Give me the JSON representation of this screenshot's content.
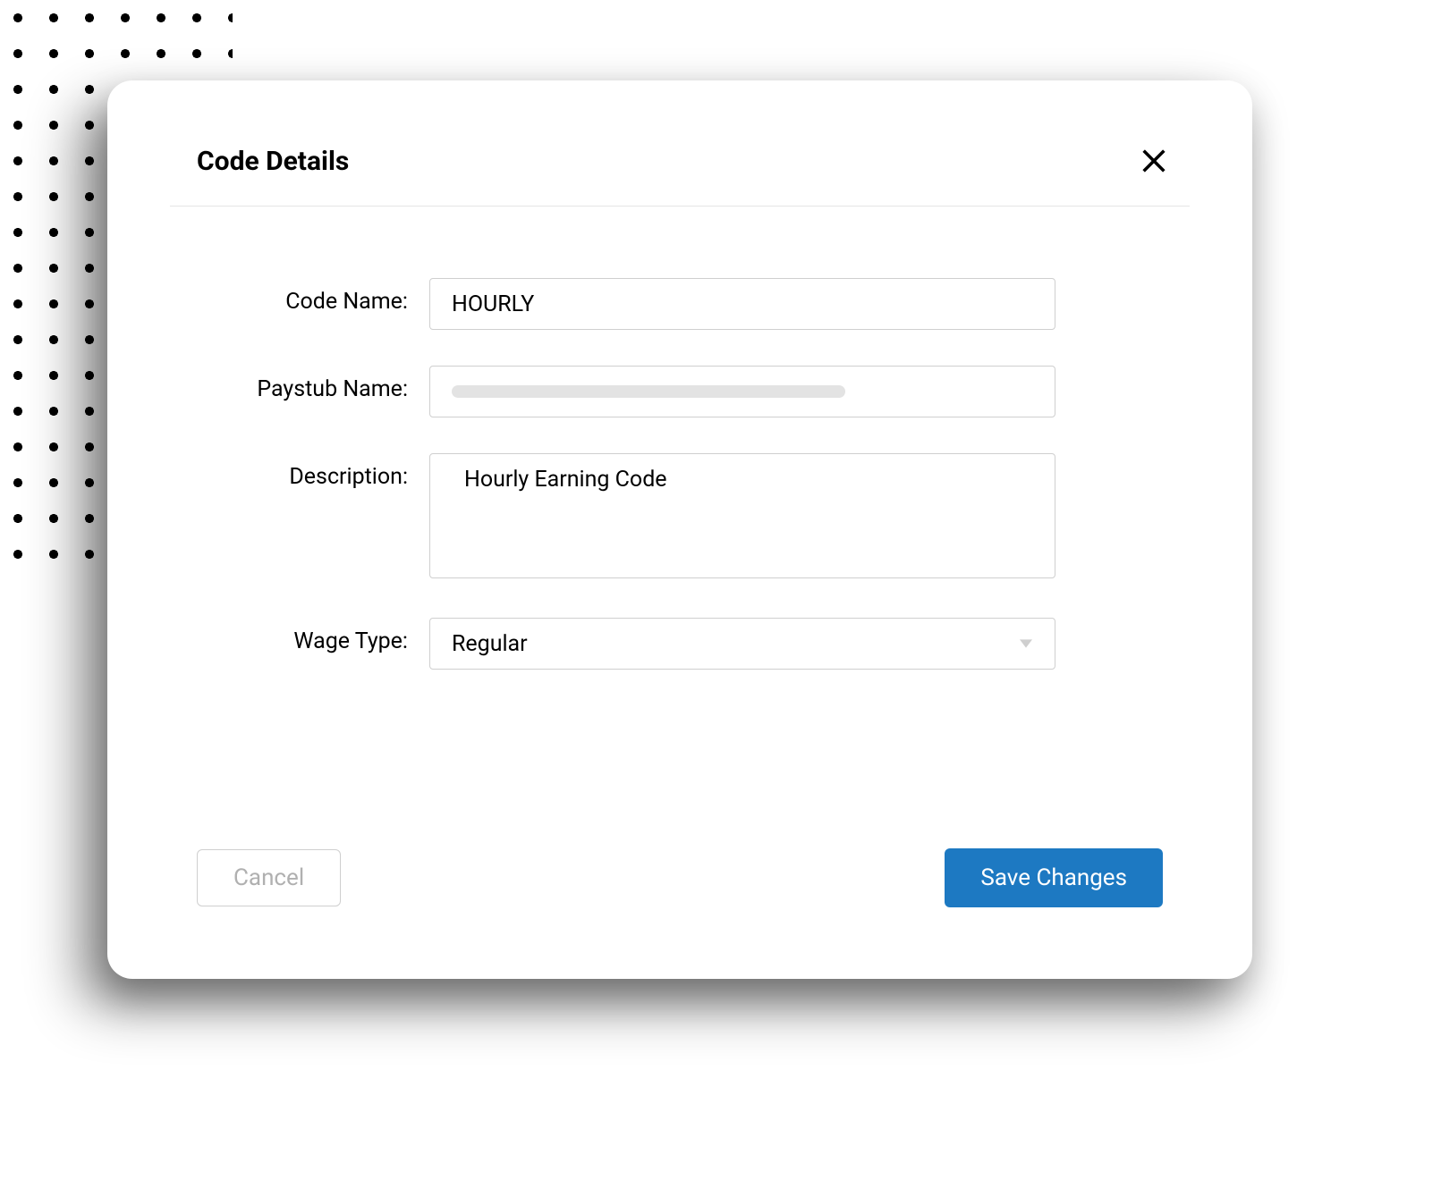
{
  "modal": {
    "title": "Code Details",
    "fields": {
      "code_name": {
        "label": "Code Name:",
        "value": "HOURLY"
      },
      "paystub_name": {
        "label": "Paystub Name:",
        "value": ""
      },
      "description": {
        "label": "Description:",
        "value": "Hourly Earning Code"
      },
      "wage_type": {
        "label": "Wage Type:",
        "selected": "Regular"
      }
    },
    "buttons": {
      "cancel": "Cancel",
      "save": "Save Changes"
    }
  }
}
